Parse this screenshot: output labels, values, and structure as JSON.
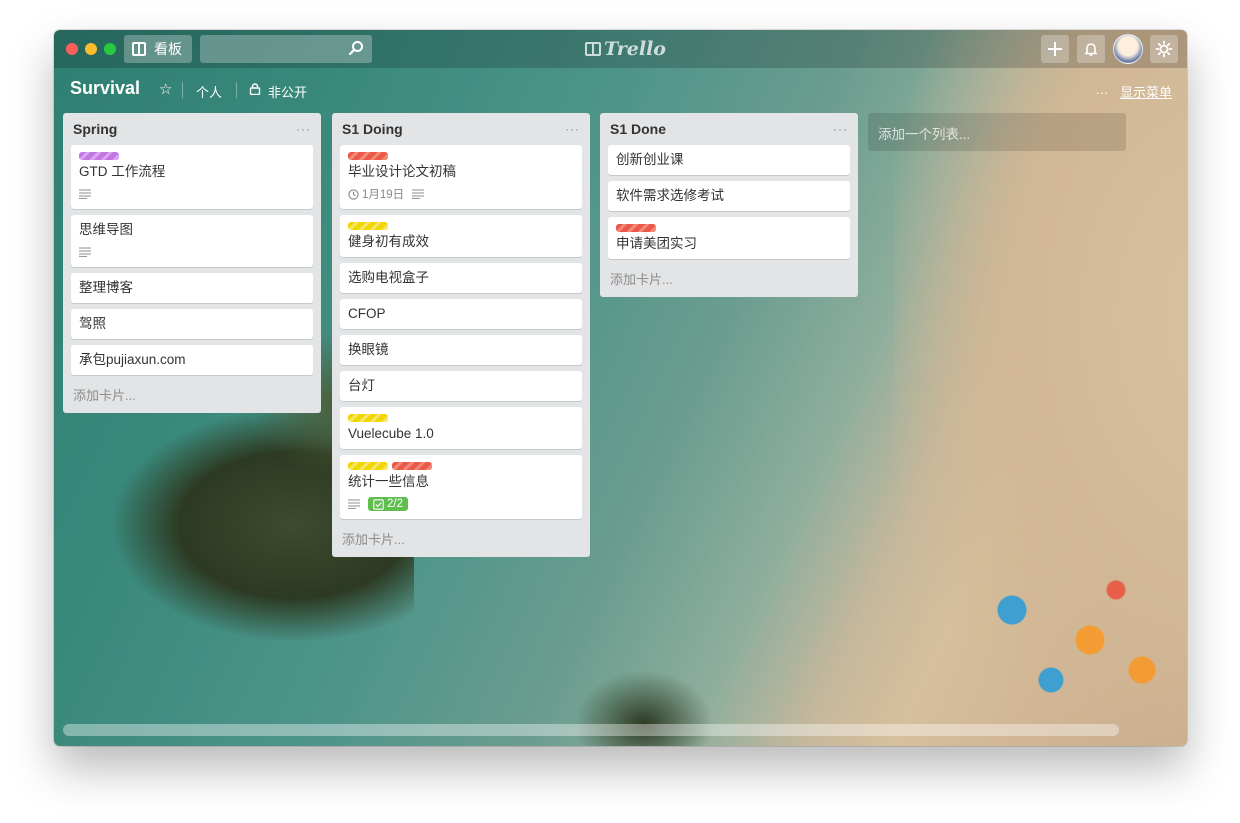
{
  "app": {
    "boards_label": "看板",
    "logo_text": "Trello"
  },
  "board": {
    "title": "Survival",
    "team": "个人",
    "visibility": "非公开",
    "more": "···",
    "show_menu": "显示菜单"
  },
  "colors": {
    "label_purple": "#c377e0",
    "label_red": "#eb5a46",
    "label_yellow": "#f2d600",
    "badge_green": "#61bd4f"
  },
  "lists": [
    {
      "title": "Spring",
      "menu": "···",
      "add_card": "添加卡片...",
      "cards": [
        {
          "title": "GTD 工作流程",
          "labels": [
            "purple"
          ],
          "has_description": true
        },
        {
          "title": "思维导图",
          "labels": [],
          "has_description": true
        },
        {
          "title": "整理博客",
          "labels": []
        },
        {
          "title": "驾照",
          "labels": []
        },
        {
          "title": "承包pujiaxun.com",
          "labels": []
        }
      ]
    },
    {
      "title": "S1 Doing",
      "menu": "···",
      "add_card": "添加卡片...",
      "cards": [
        {
          "title": "毕业设计论文初稿",
          "labels": [
            "red"
          ],
          "due": "1月19日",
          "has_description": true
        },
        {
          "title": "健身初有成效",
          "labels": [
            "yellow"
          ]
        },
        {
          "title": "选购电视盒子",
          "labels": []
        },
        {
          "title": "CFOP",
          "labels": []
        },
        {
          "title": "换眼镜",
          "labels": []
        },
        {
          "title": "台灯",
          "labels": []
        },
        {
          "title": "Vuelecube 1.0",
          "labels": [
            "yellow"
          ]
        },
        {
          "title": "统计一些信息",
          "labels": [
            "yellow",
            "red"
          ],
          "has_description": true,
          "checklist": "2/2"
        }
      ]
    },
    {
      "title": "S1 Done",
      "menu": "···",
      "add_card": "添加卡片...",
      "cards": [
        {
          "title": "创新创业课",
          "labels": []
        },
        {
          "title": "软件需求选修考试",
          "labels": []
        },
        {
          "title": "申请美团实习",
          "labels": [
            "red"
          ]
        }
      ]
    }
  ],
  "add_list": "添加一个列表..."
}
